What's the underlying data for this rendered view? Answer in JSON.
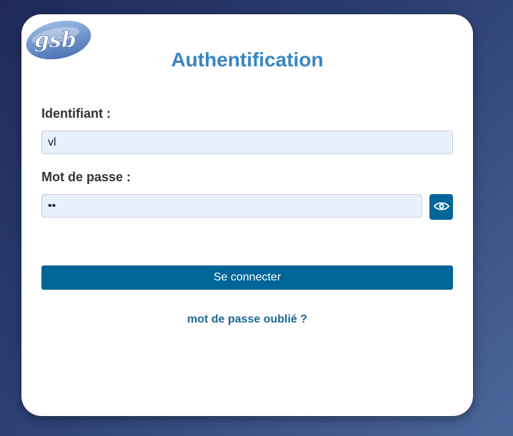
{
  "logo": {
    "text": "gsb"
  },
  "title": "Authentification",
  "form": {
    "username_label": "Identifiant :",
    "username_value": "vl",
    "password_label": "Mot de passe :",
    "password_value": "ab",
    "show_password_icon": "eye-icon",
    "submit_label": "Se connecter",
    "forgot_link": "mot de passe oublié ?"
  },
  "colors": {
    "accent": "#006699",
    "title": "#3a85c2",
    "link": "#1a6896",
    "input_bg": "#e8f0fe"
  }
}
